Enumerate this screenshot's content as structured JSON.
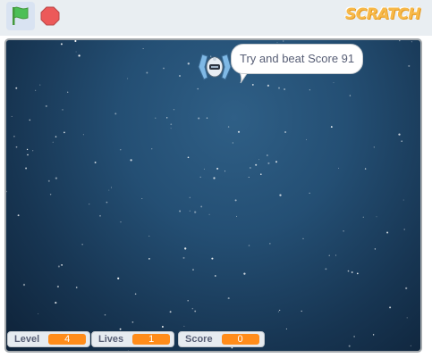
{
  "toolbar": {
    "green_flag_icon": "green-flag-icon",
    "stop_icon": "stop-sign-icon",
    "logo_text": "SCRATCH"
  },
  "stage": {
    "speech_bubble": "Try and beat Score 91",
    "sprite_icon": "spaceship-icon"
  },
  "monitors": [
    {
      "label": "Level",
      "value": "4"
    },
    {
      "label": "Lives",
      "value": "1"
    },
    {
      "label": "Score",
      "value": "0"
    }
  ],
  "colors": {
    "monitor_value": "#ff8c1a",
    "green_flag": "#4cbf56",
    "stop": "#ec5959",
    "logo": "#f7b94a"
  }
}
